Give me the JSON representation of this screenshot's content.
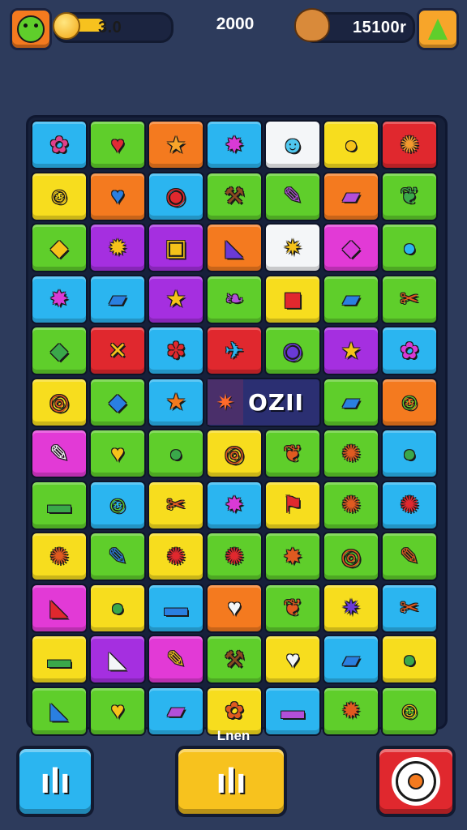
{
  "hud": {
    "coins_value": "3.0",
    "score_value": "2000",
    "gems_value": "15100r"
  },
  "colors": {
    "blue": "#2bb5f0",
    "green": "#5fce2b",
    "orange": "#f47a1f",
    "yellow": "#f7dd1e",
    "red": "#e0282e",
    "purple": "#a52fe0",
    "magenta": "#e23ad6",
    "white": "#f4f6f8"
  },
  "board": {
    "rows": [
      [
        {
          "c": "blue",
          "g": "✿",
          "i": "#e0408a",
          "n": "pink-blob-icon"
        },
        {
          "c": "green",
          "g": "♥",
          "i": "#e02a35",
          "n": "heart-icon"
        },
        {
          "c": "orange",
          "g": "★",
          "i": "#f7a52a",
          "n": "star-icon"
        },
        {
          "c": "blue",
          "g": "✸",
          "i": "#d93ad6",
          "n": "splat-icon"
        },
        {
          "c": "white",
          "g": "☻",
          "i": "#4fc7ef",
          "n": "ghost-face-icon"
        },
        {
          "c": "yellow",
          "g": "●",
          "i": "#f5c21a",
          "n": "cookie-icon"
        },
        {
          "c": "red",
          "g": "✺",
          "i": "#f29a2e",
          "n": "flower-icon"
        }
      ],
      [
        {
          "c": "yellow",
          "g": "☺",
          "i": "#f5c21a",
          "n": "smiley-cloud-icon"
        },
        {
          "c": "orange",
          "g": "♥",
          "i": "#2a7fe0",
          "n": "blue-heart-icon"
        },
        {
          "c": "blue",
          "g": "◉",
          "i": "#e0282e",
          "n": "eye-icon"
        },
        {
          "c": "green",
          "g": "⚒",
          "i": "#8a4a20",
          "n": "hammer-icon"
        },
        {
          "c": "green",
          "g": "✎",
          "i": "#b24fd9",
          "n": "feather-icon"
        },
        {
          "c": "orange",
          "g": "▰",
          "i": "#b24fd9",
          "n": "candy-bar-icon"
        },
        {
          "c": "green",
          "g": "❦",
          "i": "#3aa84a",
          "n": "leaf-icon"
        }
      ],
      [
        {
          "c": "green",
          "g": "◆",
          "i": "#f5c21a",
          "n": "gem-icon"
        },
        {
          "c": "purple",
          "g": "✹",
          "i": "#f5c21a",
          "n": "sun-icon"
        },
        {
          "c": "purple",
          "g": "▣",
          "i": "#f5c21a",
          "n": "cheese-icon"
        },
        {
          "c": "orange",
          "g": "◣",
          "i": "#6a3ad6",
          "n": "tent-icon"
        },
        {
          "c": "white",
          "g": "✷",
          "i": "#f5c21a",
          "n": "burst-icon"
        },
        {
          "c": "magenta",
          "g": "◆",
          "i": "#d93ad6",
          "n": "crystal-icon"
        },
        {
          "c": "green",
          "g": "●",
          "i": "#2bb5f0",
          "n": "blue-blob-icon"
        }
      ],
      [
        {
          "c": "blue",
          "g": "✸",
          "i": "#d93ad6",
          "n": "purple-splat-icon"
        },
        {
          "c": "blue",
          "g": "▰",
          "i": "#2a7fe0",
          "n": "book-icon"
        },
        {
          "c": "purple",
          "g": "★",
          "i": "#f5c21a",
          "n": "gold-star-icon"
        },
        {
          "c": "green",
          "g": "❧",
          "i": "#b24fd9",
          "n": "purple-leaf-icon"
        },
        {
          "c": "yellow",
          "g": "◼",
          "i": "#e0282e",
          "n": "red-box-icon"
        },
        {
          "c": "green",
          "g": "▰",
          "i": "#2a7fe0",
          "n": "blue-book-icon"
        },
        {
          "c": "green",
          "g": "✂",
          "i": "#e05a20",
          "n": "bow-icon"
        }
      ],
      [
        {
          "c": "green",
          "g": "◆",
          "i": "#3aa84a",
          "n": "green-leaf-icon"
        },
        {
          "c": "red",
          "g": "✕",
          "i": "#f5c21a",
          "n": "crossed-tools-icon"
        },
        {
          "c": "blue",
          "g": "✽",
          "i": "#e0282e",
          "n": "red-star-icon"
        },
        {
          "c": "red",
          "g": "✈",
          "i": "#2bb5f0",
          "n": "rocket-icon"
        },
        {
          "c": "green",
          "g": "◉",
          "i": "#6a3ad6",
          "n": "ring-icon"
        },
        {
          "c": "purple",
          "g": "★",
          "i": "#f5c21a",
          "n": "yellow-star-icon"
        },
        {
          "c": "blue",
          "g": "✿",
          "i": "#d93ad6",
          "n": "purple-flower-icon"
        }
      ],
      [
        {
          "c": "yellow",
          "g": "◎",
          "i": "#e05a20",
          "n": "swirl-icon"
        },
        {
          "c": "green",
          "g": "◆",
          "i": "#2a7fe0",
          "n": "blue-heart-pin-icon"
        },
        {
          "c": "blue",
          "g": "★",
          "i": "#f47a1f",
          "n": "orange-star-icon"
        },
        {
          "c": "banner",
          "g": "",
          "i": "",
          "n": ""
        },
        {
          "c": "banner",
          "g": "",
          "i": "",
          "n": ""
        },
        {
          "c": "green",
          "g": "▰",
          "i": "#2a7fe0",
          "n": "notebook-icon"
        },
        {
          "c": "orange",
          "g": "☺",
          "i": "#5fce2b",
          "n": "green-face-icon"
        }
      ],
      [
        {
          "c": "magenta",
          "g": "✎",
          "i": "#f4f6f8",
          "n": "sword-icon"
        },
        {
          "c": "green",
          "g": "♥",
          "i": "#f5c21a",
          "n": "yellow-heart-icon"
        },
        {
          "c": "green",
          "g": "●",
          "i": "#3aa84a",
          "n": "green-blob-icon"
        },
        {
          "c": "yellow",
          "g": "◎",
          "i": "#e05a20",
          "n": "snail-icon"
        },
        {
          "c": "green",
          "g": "❦",
          "i": "#e05a20",
          "n": "orange-leaf-icon"
        },
        {
          "c": "green",
          "g": "✺",
          "i": "#e05a20",
          "n": "nut-icon"
        },
        {
          "c": "blue",
          "g": "●",
          "i": "#3aa84a",
          "n": "pill-icon"
        }
      ],
      [
        {
          "c": "green",
          "g": "▬",
          "i": "#3aa84a",
          "n": "green-brick-icon"
        },
        {
          "c": "blue",
          "g": "☺",
          "i": "#5fce2b",
          "n": "alien-face-icon"
        },
        {
          "c": "yellow",
          "g": "✂",
          "i": "#e05a20",
          "n": "red-bow-icon"
        },
        {
          "c": "blue",
          "g": "✸",
          "i": "#d93ad6",
          "n": "pink-splat-icon"
        },
        {
          "c": "yellow",
          "g": "⚑",
          "i": "#e0282e",
          "n": "red-flag-icon"
        },
        {
          "c": "green",
          "g": "✺",
          "i": "#e05a20",
          "n": "gear-blob-icon"
        },
        {
          "c": "blue",
          "g": "✺",
          "i": "#e0282e",
          "n": "red-gear-blob-icon"
        }
      ],
      [
        {
          "c": "yellow",
          "g": "✺",
          "i": "#e05a20",
          "n": "orange-gear-icon"
        },
        {
          "c": "green",
          "g": "✎",
          "i": "#2a7fe0",
          "n": "wrench-icon"
        },
        {
          "c": "yellow",
          "g": "✺",
          "i": "#e0282e",
          "n": "red-cog-icon"
        },
        {
          "c": "green",
          "g": "✺",
          "i": "#e0282e",
          "n": "crab-icon"
        },
        {
          "c": "green",
          "g": "✸",
          "i": "#e05a20",
          "n": "cracker-icon"
        },
        {
          "c": "green",
          "g": "◎",
          "i": "#e05a20",
          "n": "shell-icon"
        },
        {
          "c": "green",
          "g": "✎",
          "i": "#e05a20",
          "n": "sword-orange-icon"
        }
      ],
      [
        {
          "c": "magenta",
          "g": "◣",
          "i": "#e0282e",
          "n": "red-box-lid-icon"
        },
        {
          "c": "yellow",
          "g": "●",
          "i": "#3aa84a",
          "n": "slime-icon"
        },
        {
          "c": "blue",
          "g": "▬",
          "i": "#2a7fe0",
          "n": "blue-brick-icon"
        },
        {
          "c": "orange",
          "g": "♥",
          "i": "#f4f6f8",
          "n": "white-heart-icon"
        },
        {
          "c": "green",
          "g": "❦",
          "i": "#e05a20",
          "n": "fish-icon"
        },
        {
          "c": "yellow",
          "g": "✷",
          "i": "#6a3ad6",
          "n": "sparkle-icon"
        },
        {
          "c": "blue",
          "g": "✂",
          "i": "#e05a20",
          "n": "brown-bow-icon"
        }
      ],
      [
        {
          "c": "yellow",
          "g": "▬",
          "i": "#3aa84a",
          "n": "green-domino-icon"
        },
        {
          "c": "purple",
          "g": "◣",
          "i": "#f4f6f8",
          "n": "cake-icon"
        },
        {
          "c": "magenta",
          "g": "✎",
          "i": "#f5c21a",
          "n": "paintbrush-icon"
        },
        {
          "c": "green",
          "g": "⚒",
          "i": "#8a4a20",
          "n": "axe-icon"
        },
        {
          "c": "yellow",
          "g": "♥",
          "i": "#f4f6f8",
          "n": "cream-heart-icon"
        },
        {
          "c": "blue",
          "g": "▰",
          "i": "#2a7fe0",
          "n": "blue-tome-icon"
        },
        {
          "c": "yellow",
          "g": "●",
          "i": "#3aa84a",
          "n": "green-pod-icon"
        }
      ],
      [
        {
          "c": "green",
          "g": "◣",
          "i": "#2a7fe0",
          "n": "blue-shoe-icon"
        },
        {
          "c": "green",
          "g": "♥",
          "i": "#f5c21a",
          "n": "gold-heart-icon"
        },
        {
          "c": "blue",
          "g": "▰",
          "i": "#b24fd9",
          "n": "purple-crayon-icon"
        },
        {
          "c": "yellow",
          "g": "✿",
          "i": "#e05a20",
          "n": "footprints-icon"
        },
        {
          "c": "blue",
          "g": "▬",
          "i": "#b24fd9",
          "n": "purple-domino-icon"
        },
        {
          "c": "green",
          "g": "✹",
          "i": "#e05a20",
          "n": "cog-flower-icon"
        },
        {
          "c": "green",
          "g": "☺",
          "i": "#f5c21a",
          "n": "yellow-face-icon"
        }
      ]
    ],
    "banner_text": "OZII"
  },
  "footer": {
    "label": "Lnen",
    "left_button": "ılı",
    "center_button": "ılı",
    "right_icon": "gear-icon"
  }
}
